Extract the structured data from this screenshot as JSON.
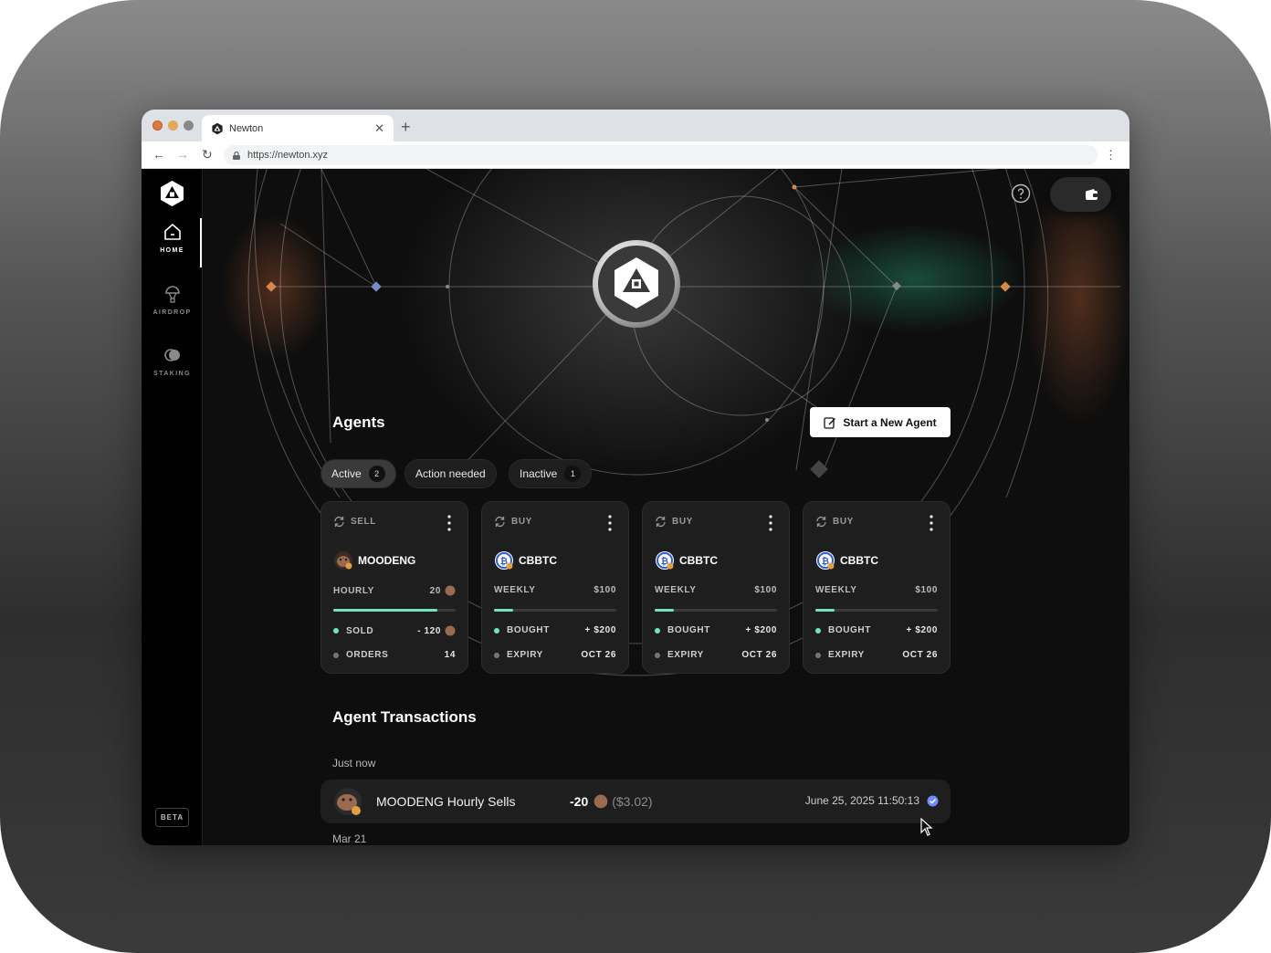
{
  "browser": {
    "tab_title": "Newton",
    "url": "https://newton.xyz"
  },
  "sidebar": {
    "items": [
      {
        "label": "HOME",
        "icon": "home-icon"
      },
      {
        "label": "AIRDROP",
        "icon": "airdrop-icon"
      },
      {
        "label": "STAKING",
        "icon": "staking-icon"
      }
    ],
    "beta_label": "BETA"
  },
  "agents": {
    "title": "Agents",
    "start_button_label": "Start a New Agent",
    "filters": [
      {
        "label": "Active",
        "count": "2"
      },
      {
        "label": "Action needed"
      },
      {
        "label": "Inactive",
        "count": "1"
      }
    ],
    "cards": [
      {
        "type": "SELL",
        "token": "MOODENG",
        "frequency": "HOURLY",
        "amount": "20",
        "progress": 0.85,
        "row2_label": "SOLD",
        "row2_value": "- 120",
        "row3_label": "ORDERS",
        "row3_value": "14"
      },
      {
        "type": "BUY",
        "token": "CBBTC",
        "frequency": "WEEKLY",
        "amount": "$100",
        "progress": 0.16,
        "row2_label": "BOUGHT",
        "row2_value": "+ $200",
        "row3_label": "EXPIRY",
        "row3_value": "OCT 26"
      },
      {
        "type": "BUY",
        "token": "CBBTC",
        "frequency": "WEEKLY",
        "amount": "$100",
        "progress": 0.16,
        "row2_label": "BOUGHT",
        "row2_value": "+ $200",
        "row3_label": "EXPIRY",
        "row3_value": "OCT 26"
      },
      {
        "type": "BUY",
        "token": "CBBTC",
        "frequency": "WEEKLY",
        "amount": "$100",
        "progress": 0.16,
        "row2_label": "BOUGHT",
        "row2_value": "+ $200",
        "row3_label": "EXPIRY",
        "row3_value": "OCT 26"
      }
    ]
  },
  "transactions": {
    "title": "Agent Transactions",
    "groups": [
      {
        "label": "Just now",
        "items": [
          {
            "name": "MOODENG Hourly Sells",
            "amount": "-20",
            "usd": "($3.02)",
            "time": "June 25, 2025 11:50:13"
          }
        ]
      },
      {
        "label": "Mar 21",
        "items": []
      }
    ]
  },
  "colors": {
    "accent_green": "#6fe3c3",
    "verified_blue": "#6b8bff"
  }
}
